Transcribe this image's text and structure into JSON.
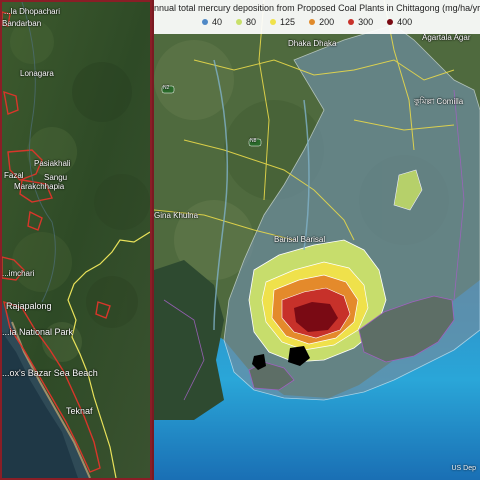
{
  "left_map": {
    "places": [
      {
        "id": "dhopachari",
        "text": "...la Dhopachari"
      },
      {
        "id": "bandarban",
        "text": "Bandarban"
      },
      {
        "id": "lonagara",
        "text": "Lonagara"
      },
      {
        "id": "pasiakhali",
        "text": "Pasiakhali"
      },
      {
        "id": "fazal",
        "text": "Fazal"
      },
      {
        "id": "sangu",
        "text": "Sangu"
      },
      {
        "id": "marakchhapia",
        "text": "Marakchhapia"
      },
      {
        "id": "himchari",
        "text": "...imchari"
      },
      {
        "id": "rajapalong",
        "text": "Rajapalong"
      },
      {
        "id": "national_park",
        "text": "...ia National Park"
      },
      {
        "id": "sea_beach",
        "text": "...ox's Bazar Sea Beach"
      },
      {
        "id": "teknaf",
        "text": "Teknaf"
      }
    ]
  },
  "right_map": {
    "legend": {
      "title": "nnual total mercury deposition from Proposed Coal Plants in Chittagong (mg/ha/yr)",
      "items": [
        {
          "label": "40",
          "color": "#4f88c6"
        },
        {
          "label": "80",
          "color": "#c8e06a"
        },
        {
          "label": "125",
          "color": "#f0e24a"
        },
        {
          "label": "200",
          "color": "#e08a2a"
        },
        {
          "label": "300",
          "color": "#c8322a"
        },
        {
          "label": "400",
          "color": "#7a0a14"
        }
      ]
    },
    "places": [
      {
        "id": "dhaka",
        "text": "Dhaka  Dhaka"
      },
      {
        "id": "agartala",
        "text": "Agartala  Agar"
      },
      {
        "id": "comilla_bn",
        "text": "কুমিল্লা  Comilla"
      },
      {
        "id": "khulna",
        "text": "Gina  Khulna"
      },
      {
        "id": "barisal",
        "text": "Barisal  Barisal"
      }
    ],
    "route_badges": [
      {
        "id": "n2",
        "text": "N2"
      },
      {
        "id": "n8",
        "text": "N8"
      }
    ],
    "credit": "US Dep"
  }
}
